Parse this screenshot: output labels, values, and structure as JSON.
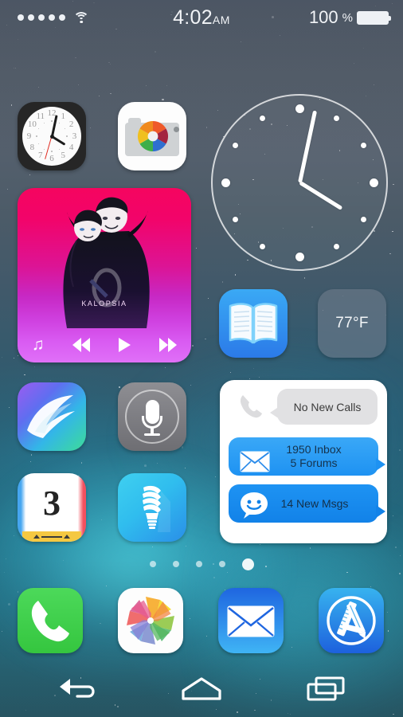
{
  "status_bar": {
    "signal_icon": "signal-dots-icon",
    "signal_bars": 5,
    "wifi_icon": "wifi-icon",
    "time": "4:02",
    "am_pm": "AM",
    "battery_percent": "100",
    "percent_symbol": "%",
    "battery_icon": "battery-full-icon"
  },
  "home_screen": {
    "icons": [
      {
        "name": "clock",
        "label": "Clock",
        "icon": "clock-icon"
      },
      {
        "name": "camera",
        "label": "Camera",
        "icon": "camera-icon"
      },
      {
        "name": "swiftkey",
        "label": "SwiftKey",
        "icon": "swiftkey-icon"
      },
      {
        "name": "voice",
        "label": "Voice Search",
        "icon": "microphone-icon"
      },
      {
        "name": "notes",
        "label": "3",
        "icon": "notes-icon",
        "badge_number": "3"
      },
      {
        "name": "flashlight",
        "label": "Flashlight",
        "icon": "lightbulb-icon"
      },
      {
        "name": "books",
        "label": "Books",
        "icon": "open-book-icon"
      }
    ]
  },
  "music_widget": {
    "album_title": "KALOPSIA",
    "artwork_alt": "vampire-couple-artwork",
    "controls": [
      {
        "name": "music-library",
        "icon": "music-note-icon",
        "glyph": "♫"
      },
      {
        "name": "previous",
        "icon": "rewind-icon"
      },
      {
        "name": "play",
        "icon": "play-icon"
      },
      {
        "name": "next",
        "icon": "fast-forward-icon"
      }
    ]
  },
  "clock_widget": {
    "icon": "analog-clock-widget",
    "hour_hand_deg": 122,
    "minute_hand_deg": 12,
    "marker_count": 12
  },
  "weather_widget": {
    "temperature": "77°F"
  },
  "notifications_widget": {
    "rows": [
      {
        "icon": "phone-icon",
        "text": "No New Calls",
        "style": "gray"
      },
      {
        "icon": "envelope-icon",
        "line1": "1950 Inbox",
        "line2": "5 Forums",
        "style": "blue-light"
      },
      {
        "icon": "smiley-icon",
        "text": "14 New Msgs",
        "style": "blue-dark"
      }
    ]
  },
  "page_indicator": {
    "total_pages": 5,
    "active_page": 5
  },
  "dock": {
    "items": [
      {
        "name": "phone",
        "label": "Phone",
        "icon": "phone-handset-icon"
      },
      {
        "name": "photos",
        "label": "Photos",
        "icon": "pinwheel-photos-icon"
      },
      {
        "name": "mail",
        "label": "Mail",
        "icon": "envelope-icon"
      },
      {
        "name": "store",
        "label": "App Store",
        "icon": "app-store-icon"
      }
    ]
  },
  "nav_bar": {
    "back": {
      "label": "Back",
      "icon": "back-arrow-icon"
    },
    "home": {
      "label": "Home",
      "icon": "home-icon"
    },
    "recents": {
      "label": "Recents",
      "icon": "recent-apps-icon"
    }
  },
  "colors": {
    "accent_blue": "#1e92f2",
    "phone_green": "#35c63f",
    "music_pink": "#f5055f",
    "music_purple": "#d95bf2",
    "flashlight_blue": "#30bdee",
    "notes_yellow": "#f5c842",
    "status_text": "#f2f4f7"
  }
}
